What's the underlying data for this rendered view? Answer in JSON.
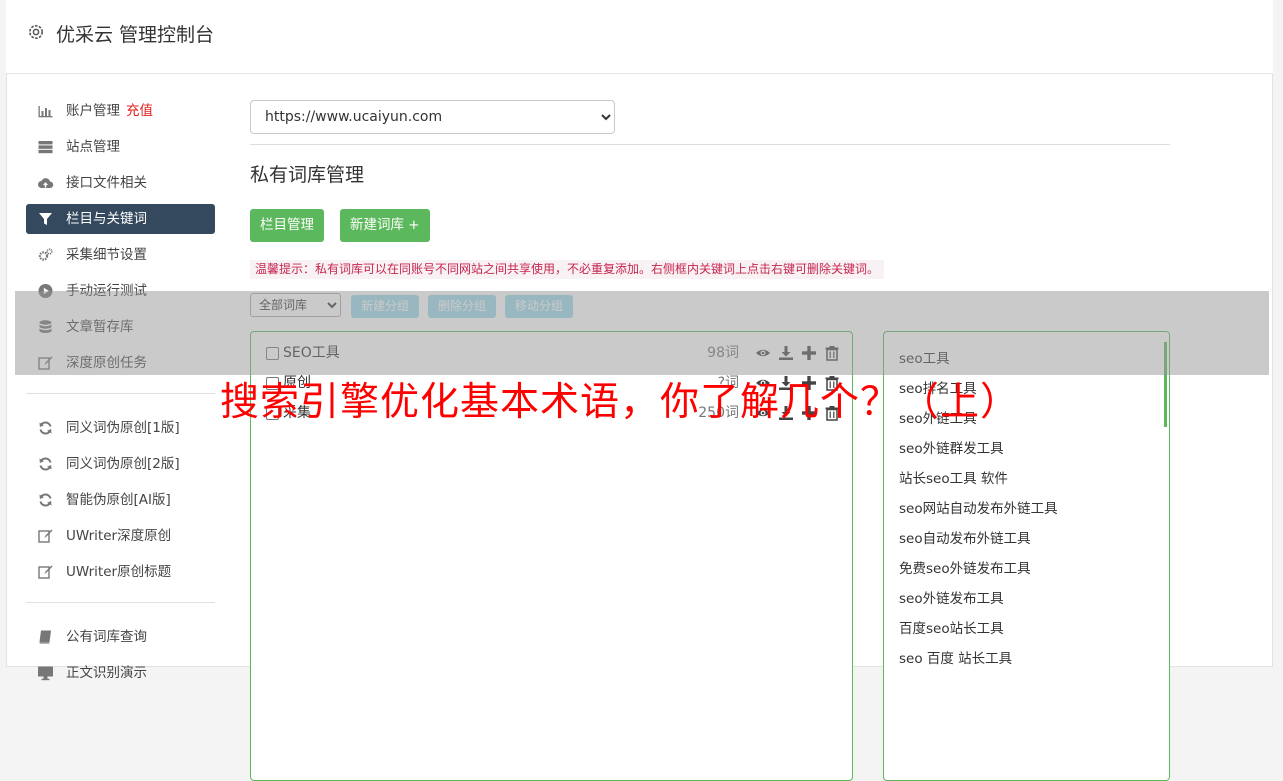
{
  "header": {
    "title": "优采云 管理控制台"
  },
  "sidebar": {
    "items": [
      {
        "label": "账户管理",
        "badge": "充值"
      },
      {
        "label": "站点管理"
      },
      {
        "label": "接口文件相关"
      },
      {
        "label": "栏目与关键词"
      },
      {
        "label": "采集细节设置"
      },
      {
        "label": "手动运行测试"
      },
      {
        "label": "文章暂存库"
      },
      {
        "label": "深度原创任务"
      },
      {
        "label": "同义词伪原创[1版]"
      },
      {
        "label": "同义词伪原创[2版]"
      },
      {
        "label": "智能伪原创[AI版]"
      },
      {
        "label": "UWriter深度原创"
      },
      {
        "label": "UWriter原创标题"
      },
      {
        "label": "公有词库查询"
      },
      {
        "label": "正文识别演示"
      }
    ]
  },
  "main": {
    "site_select": "https://www.ucaiyun.com",
    "section_title": "私有词库管理",
    "btn_columns": "栏目管理",
    "btn_new_lib": "新建词库 +",
    "tip": "温馨提示：私有词库可以在同账号不同网站之间共享使用，不必重复添加。右侧框内关键词上点击右键可删除关键词。",
    "lib_select": "全部词库",
    "btn_new_group": "新建分组",
    "btn_delete_group": "删除分组",
    "btn_move_group": "移动分组",
    "groups": [
      {
        "name": "SEO工具",
        "count": "98词"
      },
      {
        "name": "原创",
        "count": "?词"
      },
      {
        "name": "采集",
        "count": "250词"
      }
    ],
    "keywords": [
      "seo工具",
      "seo排名工具",
      "seo外链工具",
      "seo外链群发工具",
      "站长seo工具 软件",
      "seo网站自动发布外链工具",
      "seo自动发布外链工具",
      "免费seo外链发布工具",
      "seo外链发布工具",
      "百度seo站长工具",
      "seo 百度 站长工具"
    ]
  },
  "overlay": {
    "headline": "搜索引擎优化基本术语，你了解几个？（上）"
  }
}
